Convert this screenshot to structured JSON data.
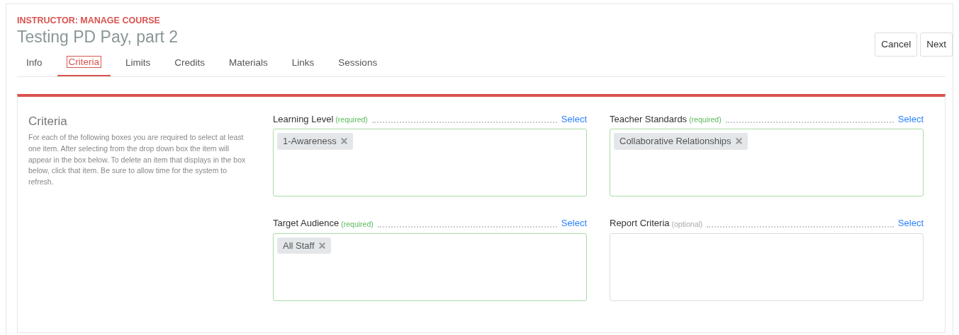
{
  "header": {
    "eyebrow": "INSTRUCTOR: MANAGE COURSE",
    "title": "Testing PD Pay, part 2"
  },
  "actions": [
    "Cancel",
    "Next"
  ],
  "tabs": [
    {
      "label": "Info",
      "selected": false
    },
    {
      "label": "Criteria",
      "selected": true
    },
    {
      "label": "Limits",
      "selected": false
    },
    {
      "label": "Credits",
      "selected": false
    },
    {
      "label": "Materials",
      "selected": false
    },
    {
      "label": "Links",
      "selected": false
    },
    {
      "label": "Sessions",
      "selected": false
    }
  ],
  "intro": {
    "title": "Criteria",
    "text": "For each of the following boxes you are required to select at least one item. After selecting from the drop down box the item will appear in the box below. To delete an item that displays in the box below, click that item. Be sure to allow time for the system to refresh."
  },
  "fields": [
    {
      "label": "Learning Level",
      "note": "(required)",
      "required": true,
      "action": "Select",
      "tags": [
        "1-Awareness"
      ]
    },
    {
      "label": "Teacher Standards",
      "note": "(required)",
      "required": true,
      "action": "Select",
      "tags": [
        "Collaborative Relationships"
      ]
    },
    {
      "label": "Target Audience",
      "note": "(required)",
      "required": true,
      "action": "Select",
      "tags": [
        "All Staff"
      ]
    },
    {
      "label": "Report Criteria",
      "note": "(optional)",
      "required": false,
      "action": "Select"
    }
  ]
}
